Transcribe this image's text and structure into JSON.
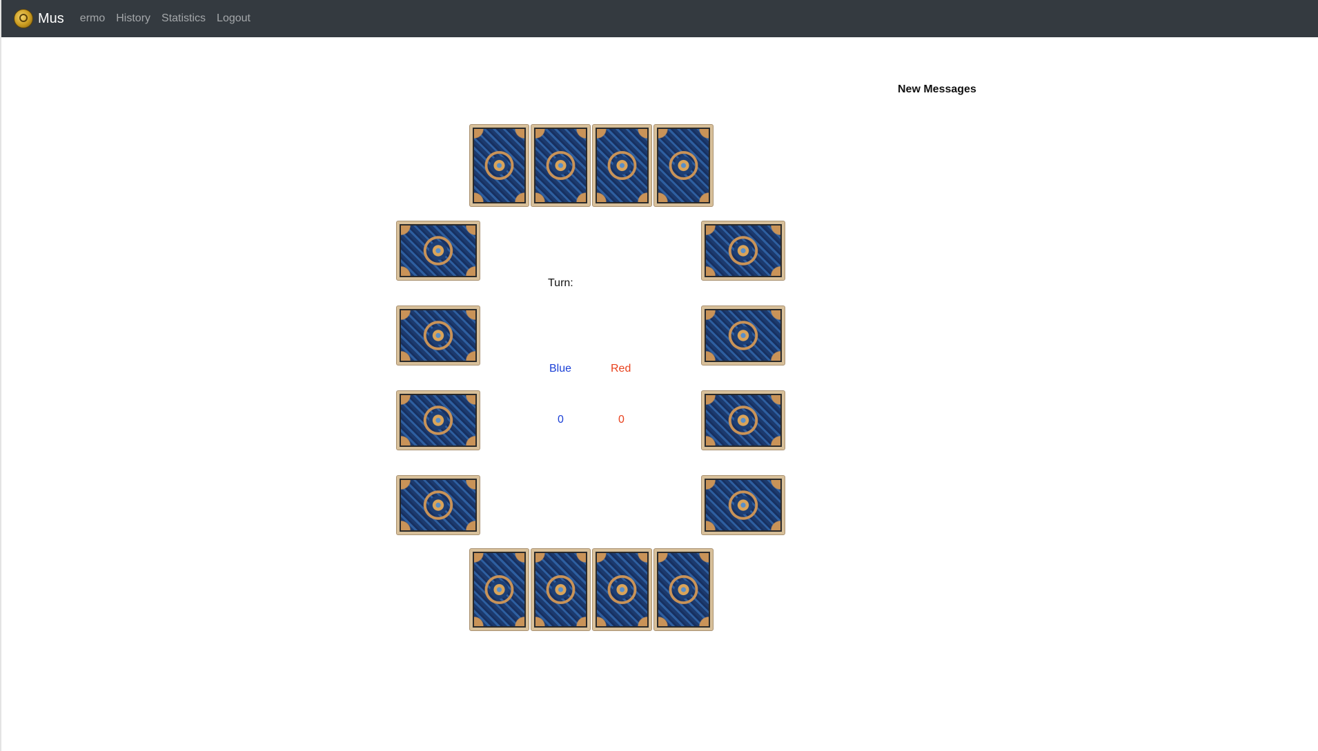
{
  "navbar": {
    "brand": "Mus",
    "links": [
      "ermo",
      "History",
      "Statistics",
      "Logout"
    ]
  },
  "game": {
    "turn_label": "Turn:",
    "teams": [
      {
        "name": "Blue",
        "score": "0",
        "color": "#1a3fd6"
      },
      {
        "name": "Red",
        "score": "0",
        "color": "#e8401c"
      }
    ],
    "card_back_icon": "card-back-icon"
  },
  "messages": {
    "title": "New Messages"
  }
}
